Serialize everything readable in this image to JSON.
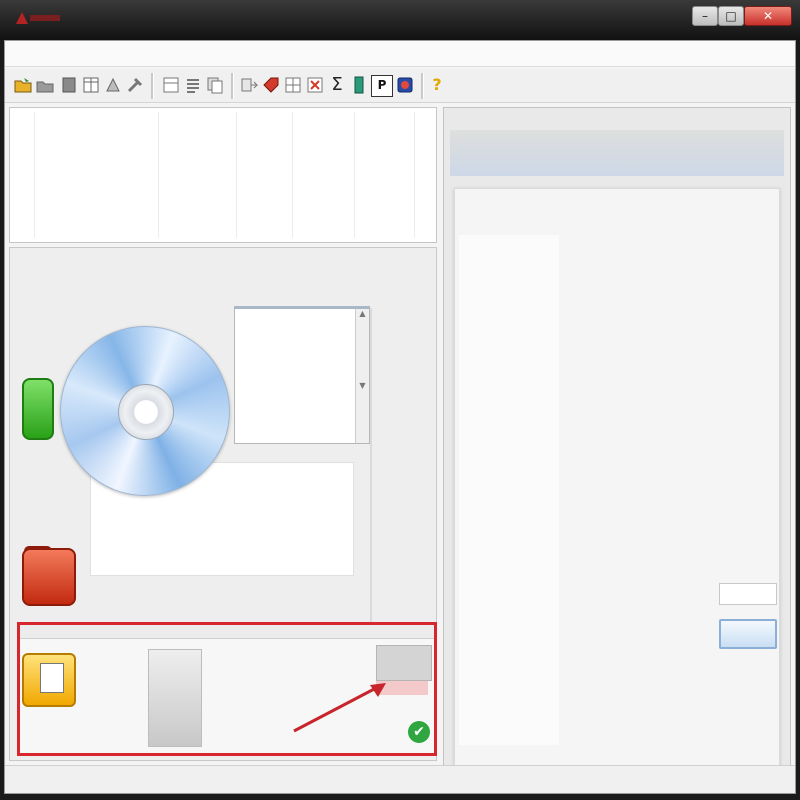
{
  "window": {
    "title": "",
    "controls": {
      "minimize": "–",
      "maximize": "□",
      "close": "✕"
    },
    "accent_color": "#d7262d"
  },
  "toolbar": {
    "icons": [
      "open-folder-icon",
      "open-file-icon",
      "save-icon",
      "columns-icon",
      "print-icon",
      "tools-icon",
      "layout-icon",
      "list-icon",
      "copy-icon",
      "transfer-icon",
      "tag-icon",
      "grid-icon",
      "delete-icon",
      "sum-icon",
      "battery-icon",
      "parking-icon",
      "shield-icon",
      "help-icon"
    ],
    "sum_glyph": "Σ",
    "p_glyph": "P",
    "help_glyph": "?"
  },
  "highlight": {
    "check_glyph": "✔",
    "border_color": "#d7262d"
  }
}
